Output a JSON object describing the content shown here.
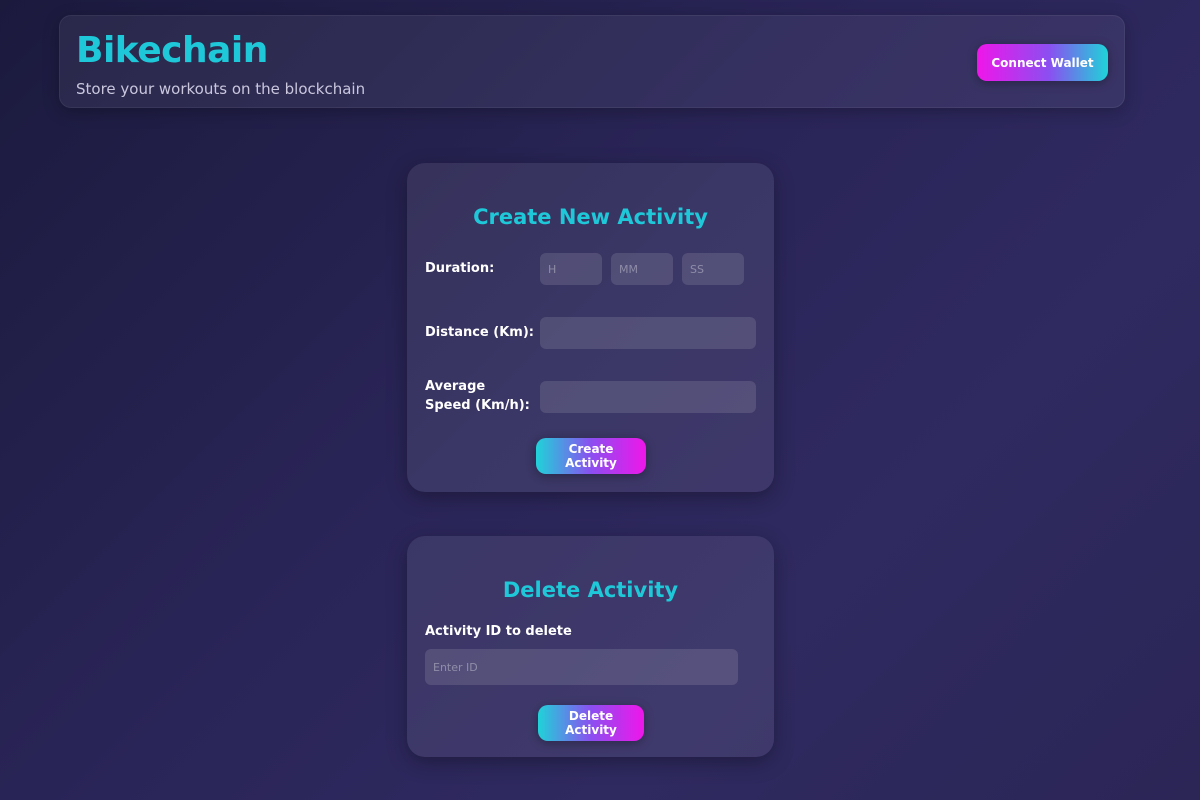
{
  "header": {
    "title": "Bikechain",
    "subtitle": "Store your workouts on the blockchain",
    "connect_label": "Connect Wallet"
  },
  "create_activity": {
    "title": "Create New Activity",
    "duration_label": "Duration:",
    "hours_placeholder": "H",
    "minutes_placeholder": "MM",
    "seconds_placeholder": "SS",
    "hours_value": "",
    "minutes_value": "",
    "seconds_value": "",
    "distance_label": "Distance (Km):",
    "distance_value": "",
    "speed_label": "Average Speed (Km/h):",
    "speed_value": "",
    "submit_label": "Create Activity"
  },
  "delete_activity": {
    "title": "Delete Activity",
    "id_label": "Activity ID to delete",
    "id_placeholder": "Enter ID",
    "id_value": "",
    "submit_label": "Delete Activity"
  },
  "colors": {
    "accent": "#1fc8d8",
    "gradient_pink": "#ef16ea",
    "gradient_cyan": "#1fd3d8",
    "background": "#2a2558"
  }
}
